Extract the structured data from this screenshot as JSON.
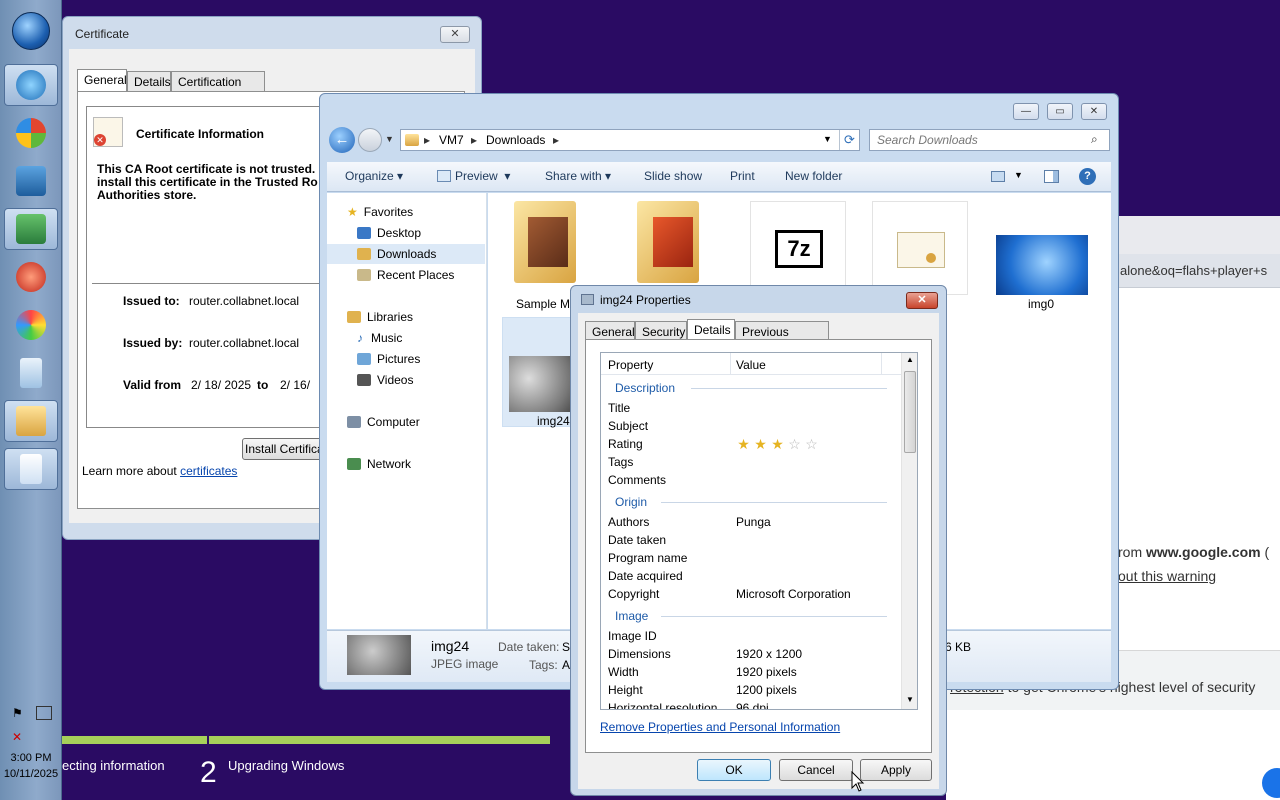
{
  "taskbar": {
    "clock_time": "3:00 PM",
    "clock_date": "10/11/2025"
  },
  "setup": {
    "step1": "ecting information",
    "step2_number": "2",
    "step2_label": "Upgrading Windows"
  },
  "chrome": {
    "url_fragment": "alone&oq=flahs+player+s",
    "from_prefix": "rom ",
    "from_domain": "www.google.com",
    "from_paren": " (",
    "warning_link": "out this warning",
    "protection_link": "rotection",
    "protection_text": " to get Chrome's highest level of security"
  },
  "certificate": {
    "title": "Certificate",
    "close": "✕",
    "tabs": [
      "General",
      "Details",
      "Certification Path"
    ],
    "info_heading": "Certificate Information",
    "warning_line1": "This CA Root certificate is not trusted.",
    "warning_line2": "install this certificate in the Trusted Ro",
    "warning_line3": "Authorities store.",
    "issued_to_label": "Issued to:",
    "issued_to_value": "router.collabnet.local",
    "issued_by_label": "Issued by:",
    "issued_by_value": "router.collabnet.local",
    "valid_from_label": "Valid from",
    "valid_from_value": "2/ 18/ 2025",
    "valid_to_label": "to",
    "valid_to_value": "2/ 16/",
    "install_button": "Install Certificat",
    "learn_more_text": "Learn more about ",
    "learn_more_link": "certificates"
  },
  "explorer": {
    "breadcrumb": [
      "VM7",
      "Downloads"
    ],
    "search_placeholder": "Search Downloads",
    "commands": [
      "Organize",
      "Preview",
      "Share with",
      "Slide show",
      "Print",
      "New folder"
    ],
    "nav": {
      "favorites": "Favorites",
      "desktop": "Desktop",
      "downloads": "Downloads",
      "recent": "Recent Places",
      "libraries": "Libraries",
      "music": "Music",
      "pictures": "Pictures",
      "videos": "Videos",
      "computer": "Computer",
      "network": "Network"
    },
    "files": {
      "sample": "Sample M",
      "img24": "img24",
      "img0": "img0",
      "sevenzip_label": "7z"
    },
    "details": {
      "name": "img24",
      "type": "JPEG image",
      "date_label": "Date taken:",
      "date_value": "Sp",
      "tags_label": "Tags:",
      "tags_value": "A",
      "size_fragment": "6 KB"
    }
  },
  "properties": {
    "title": "img24 Properties",
    "tabs": [
      "General",
      "Security",
      "Details",
      "Previous Versions"
    ],
    "col_property": "Property",
    "col_value": "Value",
    "sections": {
      "description": "Description",
      "origin": "Origin",
      "image": "Image"
    },
    "rows": {
      "title": "Title",
      "subject": "Subject",
      "rating": "Rating",
      "tags": "Tags",
      "comments": "Comments",
      "authors": "Authors",
      "authors_value": "Punga",
      "date_taken": "Date taken",
      "program_name": "Program name",
      "date_acquired": "Date acquired",
      "copyright": "Copyright",
      "copyright_value": "Microsoft Corporation",
      "image_id": "Image ID",
      "dimensions": "Dimensions",
      "dimensions_value": "1920 x 1200",
      "width": "Width",
      "width_value": "1920 pixels",
      "height": "Height",
      "height_value": "1200 pixels",
      "hres": "Horizontal resolution",
      "hres_value": "96 dpi"
    },
    "rating_stars": 3,
    "rating_max": 5,
    "remove_link": "Remove Properties and Personal Information",
    "ok": "OK",
    "cancel": "Cancel",
    "apply": "Apply"
  }
}
